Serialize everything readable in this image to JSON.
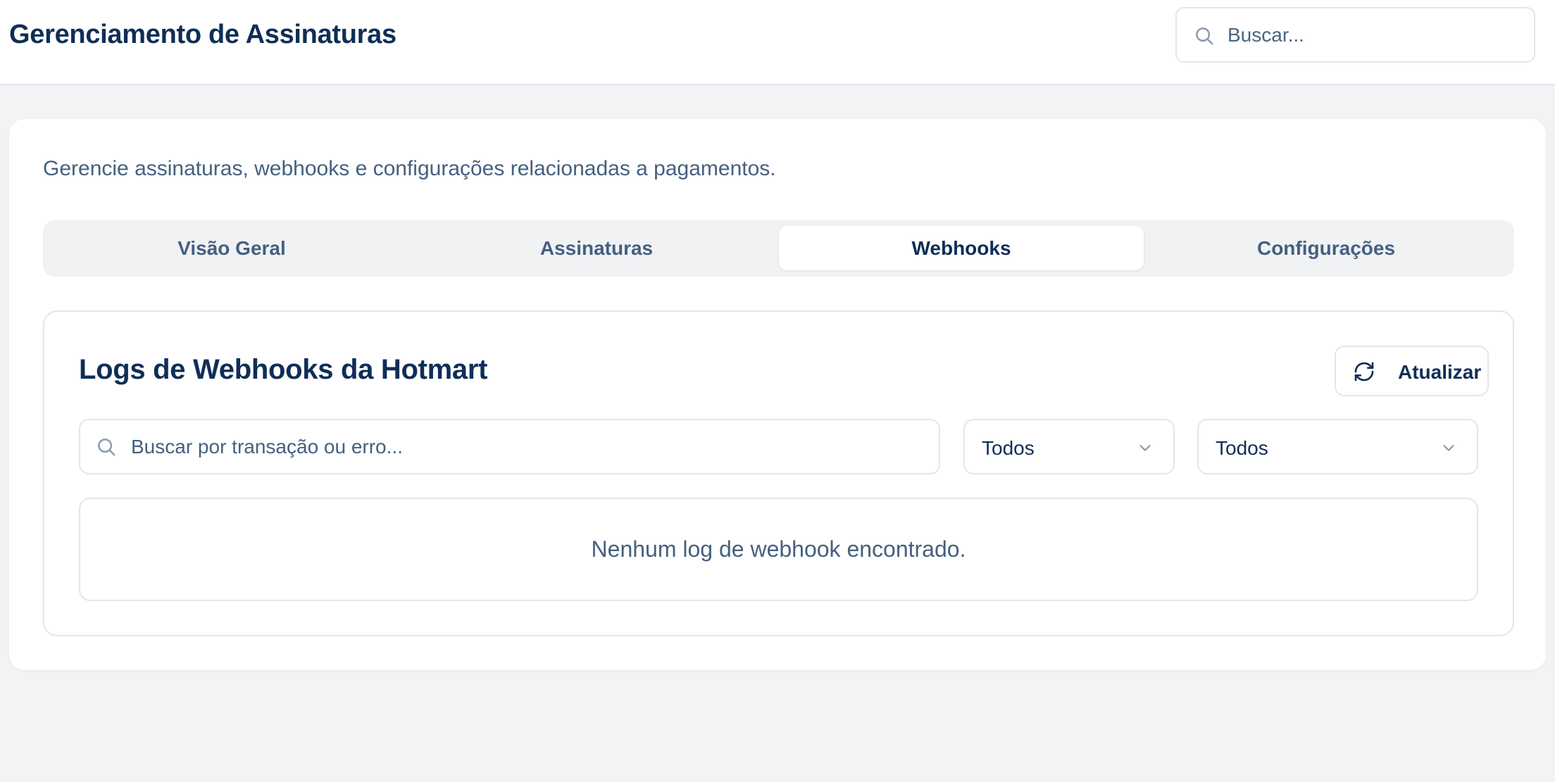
{
  "header": {
    "title": "Gerenciamento de Assinaturas",
    "search_placeholder": "Buscar..."
  },
  "main": {
    "subtitle": "Gerencie assinaturas, webhooks e configurações relacionadas a pagamentos.",
    "tabs": [
      {
        "label": "Visão Geral",
        "active": false
      },
      {
        "label": "Assinaturas",
        "active": false
      },
      {
        "label": "Webhooks",
        "active": true
      },
      {
        "label": "Configurações",
        "active": false
      }
    ]
  },
  "webhooks": {
    "title": "Logs de Webhooks da Hotmart",
    "refresh_label": "Atualizar",
    "search_placeholder": "Buscar por transação ou erro...",
    "status_filter": {
      "selected": "Todos"
    },
    "event_filter": {
      "selected": "Todos"
    },
    "empty_message": "Nenhum log de webhook encontrado."
  },
  "icons": {
    "top_search": "search-icon",
    "log_search": "search-icon",
    "refresh": "refresh-icon",
    "dropdown": "chevron-down-icon"
  },
  "colors": {
    "primary_text": "#0f2e57",
    "muted_text": "#45607f",
    "page_background": "#f2f3f5",
    "border": "#e2e6ec"
  }
}
